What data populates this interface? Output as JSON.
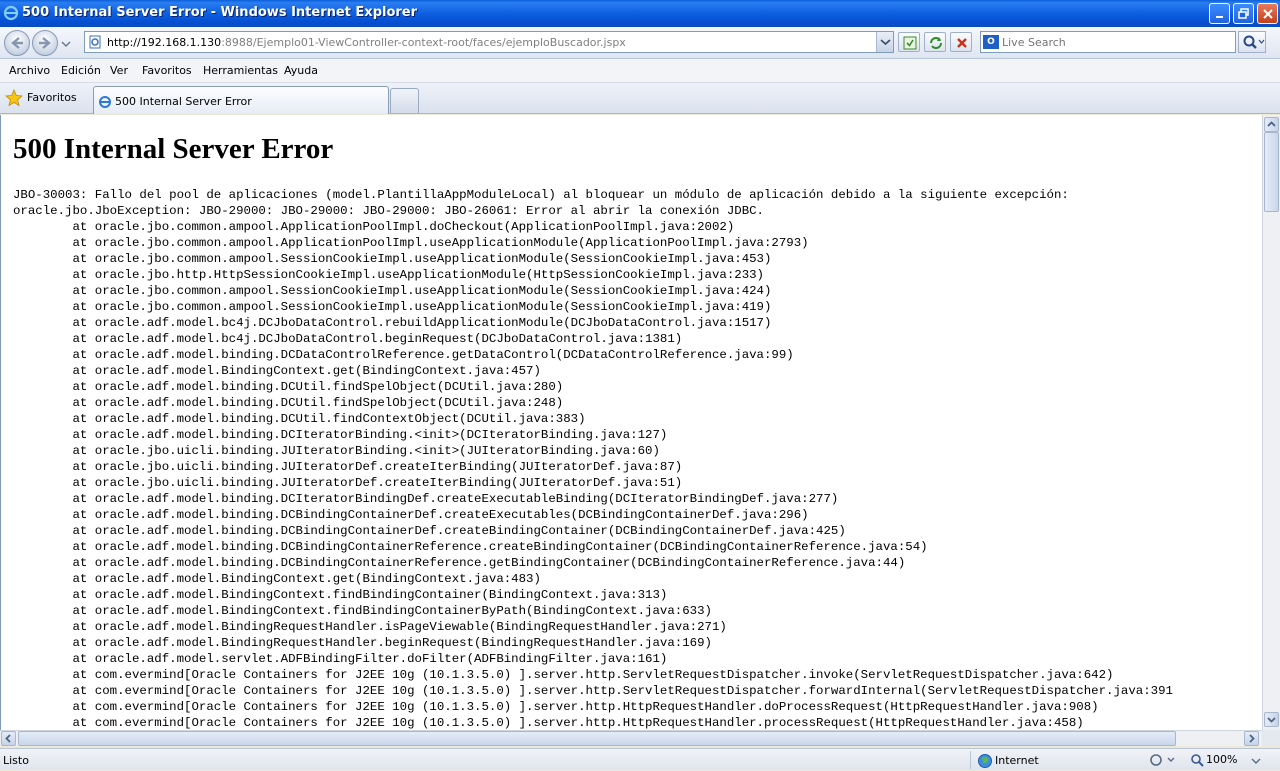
{
  "window": {
    "title": "500 Internal Server Error - Windows Internet Explorer"
  },
  "nav": {
    "url_scheme_host": "http://192.168.1.130",
    "url_rest": ":8988/Ejemplo01-ViewController-context-root/faces/ejemploBuscador.jspx",
    "search_placeholder": "Live Search"
  },
  "menu": [
    "Archivo",
    "Edición",
    "Ver",
    "Favoritos",
    "Herramientas",
    "Ayuda"
  ],
  "favbar": {
    "favorites_label": "Favoritos",
    "tab_title": "500 Internal Server Error"
  },
  "page": {
    "heading": "500 Internal Server Error",
    "lines": [
      "JBO-30003: Fallo del pool de aplicaciones (model.PlantillaAppModuleLocal) al bloquear un módulo de aplicación debido a la siguiente excepción:",
      "oracle.jbo.JboException: JBO-29000: JBO-29000: JBO-29000: JBO-26061: Error al abrir la conexión JDBC.",
      "        at oracle.jbo.common.ampool.ApplicationPoolImpl.doCheckout(ApplicationPoolImpl.java:2002)",
      "        at oracle.jbo.common.ampool.ApplicationPoolImpl.useApplicationModule(ApplicationPoolImpl.java:2793)",
      "        at oracle.jbo.common.ampool.SessionCookieImpl.useApplicationModule(SessionCookieImpl.java:453)",
      "        at oracle.jbo.http.HttpSessionCookieImpl.useApplicationModule(HttpSessionCookieImpl.java:233)",
      "        at oracle.jbo.common.ampool.SessionCookieImpl.useApplicationModule(SessionCookieImpl.java:424)",
      "        at oracle.jbo.common.ampool.SessionCookieImpl.useApplicationModule(SessionCookieImpl.java:419)",
      "        at oracle.adf.model.bc4j.DCJboDataControl.rebuildApplicationModule(DCJboDataControl.java:1517)",
      "        at oracle.adf.model.bc4j.DCJboDataControl.beginRequest(DCJboDataControl.java:1381)",
      "        at oracle.adf.model.binding.DCDataControlReference.getDataControl(DCDataControlReference.java:99)",
      "        at oracle.adf.model.BindingContext.get(BindingContext.java:457)",
      "        at oracle.adf.model.binding.DCUtil.findSpelObject(DCUtil.java:280)",
      "        at oracle.adf.model.binding.DCUtil.findSpelObject(DCUtil.java:248)",
      "        at oracle.adf.model.binding.DCUtil.findContextObject(DCUtil.java:383)",
      "        at oracle.adf.model.binding.DCIteratorBinding.<init>(DCIteratorBinding.java:127)",
      "        at oracle.jbo.uicli.binding.JUIteratorBinding.<init>(JUIteratorBinding.java:60)",
      "        at oracle.jbo.uicli.binding.JUIteratorDef.createIterBinding(JUIteratorDef.java:87)",
      "        at oracle.jbo.uicli.binding.JUIteratorDef.createIterBinding(JUIteratorDef.java:51)",
      "        at oracle.adf.model.binding.DCIteratorBindingDef.createExecutableBinding(DCIteratorBindingDef.java:277)",
      "        at oracle.adf.model.binding.DCBindingContainerDef.createExecutables(DCBindingContainerDef.java:296)",
      "        at oracle.adf.model.binding.DCBindingContainerDef.createBindingContainer(DCBindingContainerDef.java:425)",
      "        at oracle.adf.model.binding.DCBindingContainerReference.createBindingContainer(DCBindingContainerReference.java:54)",
      "        at oracle.adf.model.binding.DCBindingContainerReference.getBindingContainer(DCBindingContainerReference.java:44)",
      "        at oracle.adf.model.BindingContext.get(BindingContext.java:483)",
      "        at oracle.adf.model.BindingContext.findBindingContainer(BindingContext.java:313)",
      "        at oracle.adf.model.BindingContext.findBindingContainerByPath(BindingContext.java:633)",
      "        at oracle.adf.model.BindingRequestHandler.isPageViewable(BindingRequestHandler.java:271)",
      "        at oracle.adf.model.BindingRequestHandler.beginRequest(BindingRequestHandler.java:169)",
      "        at oracle.adf.model.servlet.ADFBindingFilter.doFilter(ADFBindingFilter.java:161)",
      "        at com.evermind[Oracle Containers for J2EE 10g (10.1.3.5.0) ].server.http.ServletRequestDispatcher.invoke(ServletRequestDispatcher.java:642)",
      "        at com.evermind[Oracle Containers for J2EE 10g (10.1.3.5.0) ].server.http.ServletRequestDispatcher.forwardInternal(ServletRequestDispatcher.java:391",
      "        at com.evermind[Oracle Containers for J2EE 10g (10.1.3.5.0) ].server.http.HttpRequestHandler.doProcessRequest(HttpRequestHandler.java:908)",
      "        at com.evermind[Oracle Containers for J2EE 10g (10.1.3.5.0) ].server.http.HttpRequestHandler.processRequest(HttpRequestHandler.java:458)"
    ]
  },
  "statusbar": {
    "status": "Listo",
    "zone": "Internet",
    "zoom": "100%"
  },
  "colors": {
    "titlebar": "#0a5fd8",
    "chrome": "#ece9d8"
  },
  "icons": {
    "app": "ie-logo-icon",
    "back": "back-arrow-icon",
    "forward": "forward-arrow-icon",
    "favorites": "star-icon",
    "zone": "globe-icon"
  }
}
